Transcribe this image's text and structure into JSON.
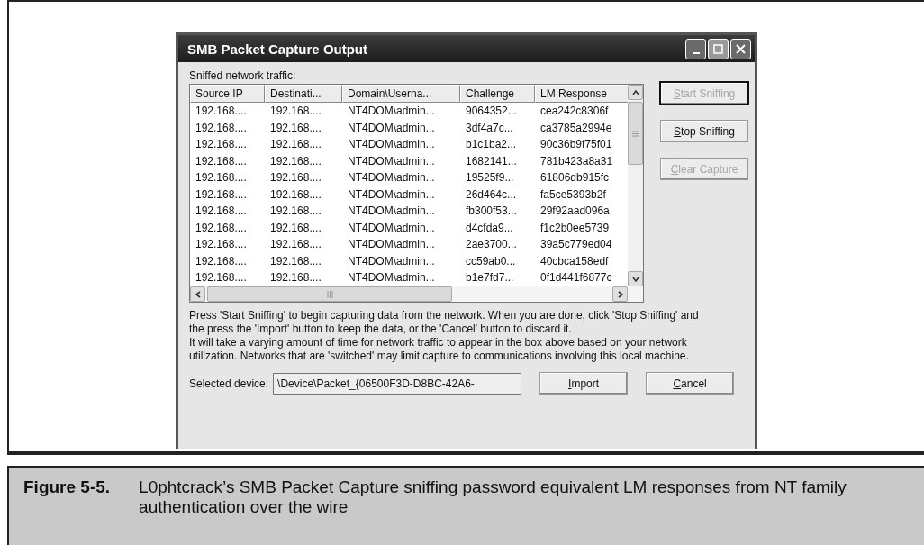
{
  "window": {
    "title": "SMB Packet Capture Output"
  },
  "traffic_label": "Sniffed network traffic:",
  "table": {
    "columns": [
      "Source IP",
      "Destinati...",
      "Domain\\Userna...",
      "Challenge",
      "LM Response"
    ],
    "rows": [
      [
        "192.168....",
        "192.168....",
        "NT4DOM\\admin...",
        "9064352...",
        "cea242c8306f"
      ],
      [
        "192.168....",
        "192.168....",
        "NT4DOM\\admin...",
        "3df4a7c...",
        "ca3785a2994e"
      ],
      [
        "192.168....",
        "192.168....",
        "NT4DOM\\admin...",
        "b1c1ba2...",
        "90c36b9f75f01"
      ],
      [
        "192.168....",
        "192.168....",
        "NT4DOM\\admin...",
        "1682141...",
        "781b423a8a31"
      ],
      [
        "192.168....",
        "192.168....",
        "NT4DOM\\admin...",
        "19525f9...",
        "61806db915fc"
      ],
      [
        "192.168....",
        "192.168....",
        "NT4DOM\\admin...",
        "26d464c...",
        "fa5ce5393b2f"
      ],
      [
        "192.168....",
        "192.168....",
        "NT4DOM\\admin...",
        "fb300f53...",
        "29f92aad096a"
      ],
      [
        "192.168....",
        "192.168....",
        "NT4DOM\\admin...",
        "d4cfda9...",
        "f1c2b0ee5739"
      ],
      [
        "192.168....",
        "192.168....",
        "NT4DOM\\admin...",
        "2ae3700...",
        "39a5c779ed04"
      ],
      [
        "192.168....",
        "192.168....",
        "NT4DOM\\admin...",
        "cc59ab0...",
        "40cbca158edf"
      ],
      [
        "192.168....",
        "192.168....",
        "NT4DOM\\admin...",
        "b1e7fd7...",
        "0f1d441f6877c"
      ]
    ]
  },
  "side_buttons": [
    {
      "label": "Start Sniffing",
      "disabled": true,
      "default": true
    },
    {
      "label": "Stop Sniffing",
      "disabled": false,
      "default": false
    },
    {
      "label": "Clear Capture",
      "disabled": true,
      "default": false
    }
  ],
  "instructions": [
    "Press 'Start Sniffing' to begin capturing data from the network. When you are done, click 'Stop Sniffing' and the press the 'Import' button to keep the data, or the 'Cancel' button to discard it.",
    "It will take a varying amount of time for network traffic to appear in the box above based on your network utilization. Networks that are 'switched' may limit capture to communications involving this local machine."
  ],
  "device": {
    "label": "Selected device:",
    "value": "\\Device\\Packet_{06500F3D-D8BC-42A6-"
  },
  "buttons": [
    {
      "label": "Import"
    },
    {
      "label": "Cancel"
    }
  ],
  "caption": {
    "number": "Figure 5-5.",
    "text": "L0phtcrack’s SMB Packet Capture sniffing password equivalent LM responses from NT family authentication over the wire"
  }
}
